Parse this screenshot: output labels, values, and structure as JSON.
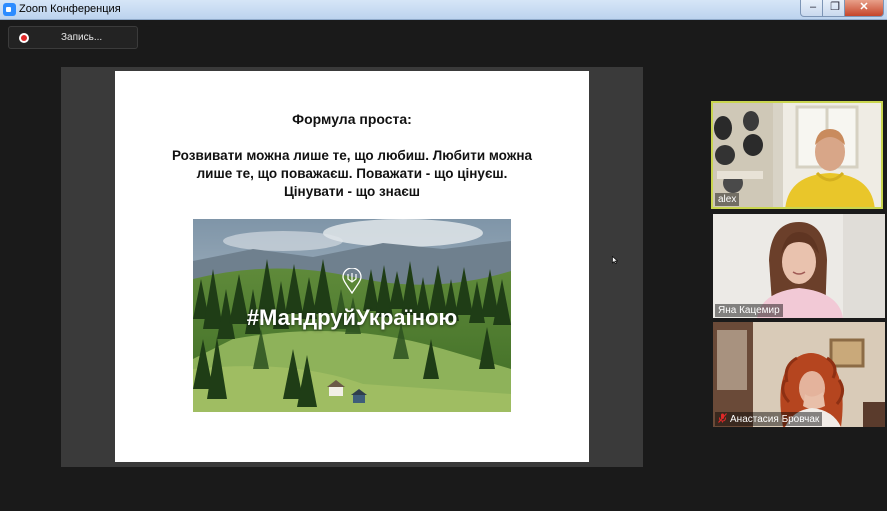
{
  "window": {
    "title": "Zoom Конференция",
    "buttons": {
      "minimize": "–",
      "maximize": "❐",
      "close": "✕"
    }
  },
  "toolbar": {
    "record_label": "Запись..."
  },
  "slide": {
    "heading": "Формула проста:",
    "quote_lines": [
      "Розвивати можна лише те, що любиш. Любити можна",
      "лише те, що поважаєш. Поважати - що цінуєш.",
      "Цінувати - що знаєш"
    ],
    "image_hashtag": "#МандруйУкраїною"
  },
  "participants": [
    {
      "name": "alex",
      "active": true,
      "muted": false
    },
    {
      "name": "Яна Кацемир",
      "active": false,
      "muted": false
    },
    {
      "name": "Анастасия Бровчак",
      "active": false,
      "muted": true
    }
  ],
  "icons": {
    "app": "zoom-app-icon",
    "record": "record-icon",
    "muted": "muted-mic-icon",
    "cursor": "mouse-cursor-icon"
  },
  "colors": {
    "active_speaker_border": "#c9d54f",
    "record_dot": "#e02828",
    "muted_mic": "#e02828",
    "app_accent": "#2d8cff"
  }
}
